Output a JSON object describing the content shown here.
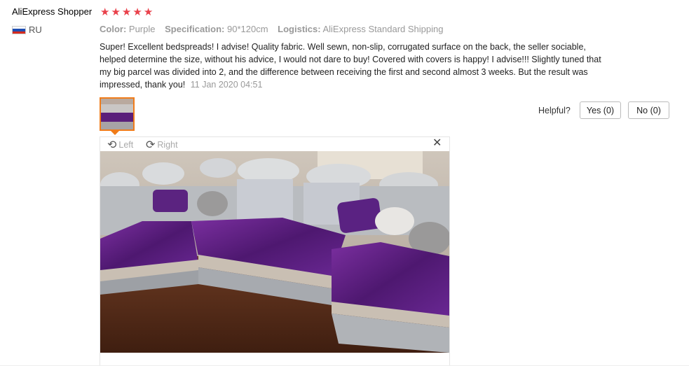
{
  "reviewer": {
    "name": "AliExpress Shopper",
    "country": "RU",
    "rating": 5
  },
  "specs": {
    "color_key": "Color:",
    "color_val": "Purple",
    "spec_key": "Specification:",
    "spec_val": "90*120cm",
    "logistics_key": "Logistics:",
    "logistics_val": "AliExpress Standard Shipping"
  },
  "review": {
    "text": "Super! Excellent bedspreads! I advise! Quality fabric. Well sewn, non-slip, corrugated surface on the back, the seller sociable, helped determine the size, without his advice, I would not dare to buy! Covered with covers is happy! I advise!!! Slightly tuned that my big parcel was divided into 2, and the difference between receiving the first and second almost 3 weeks. But the result was impressed, thank you!",
    "date": "11 Jan 2020 04:51"
  },
  "helpful": {
    "label": "Helpful?",
    "yes": "Yes (0)",
    "no": "No (0)"
  },
  "viewer": {
    "rotate_left": "Left",
    "rotate_right": "Right",
    "close_icon": "close-icon"
  },
  "colors": {
    "star": "#e9414b",
    "thumb_border": "#f07c1a",
    "fabric": "#5a1f7a"
  }
}
